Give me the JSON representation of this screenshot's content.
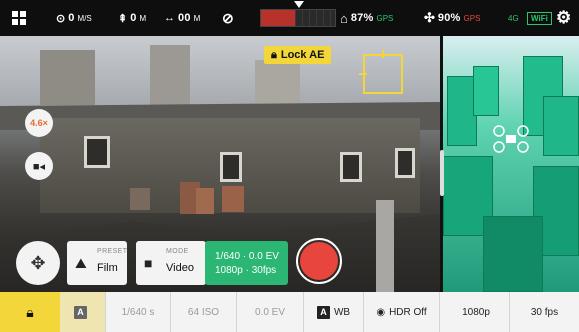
{
  "topbar": {
    "speed": "0",
    "speed_unit": "M/S",
    "altitude": "0",
    "altitude_unit": "M",
    "distance": "00",
    "distance_unit": "M",
    "controller_battery": "87%",
    "gps_left": "GPS",
    "drone_battery": "90%",
    "gps_right": "GPS",
    "network": "4G",
    "wifi": "WiFi"
  },
  "overlays": {
    "lock_ae_label": "Lock AE",
    "zoom_label": "4.6×"
  },
  "controls": {
    "preset_caption": "PRESET",
    "preset_value": "Film",
    "mode_caption": "MODE",
    "mode_value": "Video",
    "exposure_line1": "1/640 · 0.0 EV",
    "exposure_line2": "1080p · 30fps"
  },
  "bottombar": {
    "auto_label": "A",
    "shutter": "1/640 s",
    "iso": "64 ISO",
    "ev": "0.0 EV",
    "wb_badge": "A",
    "wb_label": "WB",
    "hdr_label": "HDR Off",
    "resolution": "1080p",
    "framerate": "30 fps"
  },
  "colors": {
    "accent_yellow": "#f2d63a",
    "record_red": "#e8453c",
    "exposure_green": "#2bb673",
    "status_green": "#28c76f"
  },
  "icons": [
    "grid-menu-icon",
    "speedometer-icon",
    "altitude-icon",
    "distance-icon",
    "no-gps-icon",
    "controller-icon",
    "fan-icon",
    "settings-icon",
    "lock-icon",
    "focus-reticle-icon",
    "video-camera-icon",
    "joystick-icon",
    "film-icon",
    "record-icon",
    "hdr-icon"
  ]
}
